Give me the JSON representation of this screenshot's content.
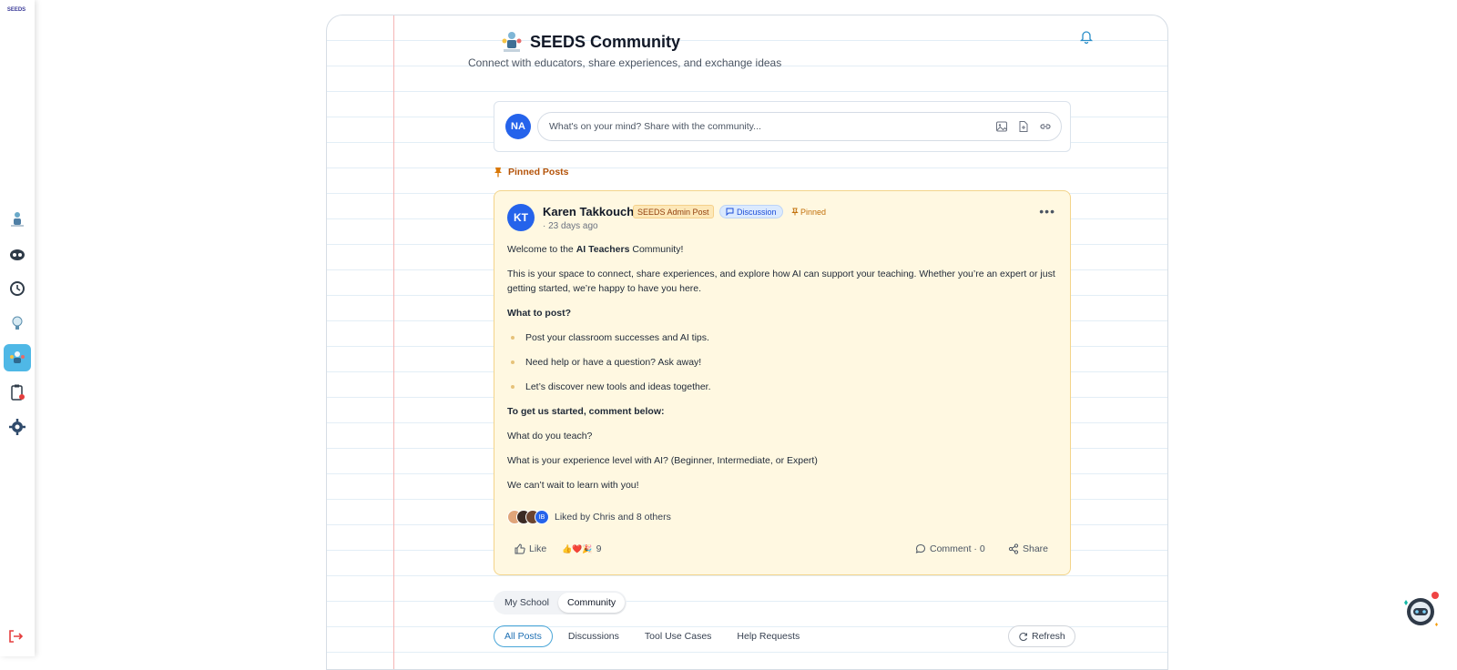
{
  "sidebar": {
    "logo_text": "SEEDS",
    "items": [
      {
        "icon": "robot-teacher-icon"
      },
      {
        "icon": "robot-eye-icon"
      },
      {
        "icon": "clock-icon"
      },
      {
        "icon": "lightbulb-icon"
      },
      {
        "icon": "community-icon",
        "active": true
      },
      {
        "icon": "clipboard-icon"
      },
      {
        "icon": "gear-icon"
      }
    ],
    "logout_icon": "logout-icon"
  },
  "header": {
    "title": "SEEDS Community",
    "subtitle": "Connect with educators, share experiences, and exchange ideas"
  },
  "composer": {
    "avatar_initials": "NA",
    "placeholder": "What's on your mind? Share with the community..."
  },
  "pinned_label": "Pinned Posts",
  "post": {
    "avatar_initials": "KT",
    "author": "Karen Takkouch",
    "badge_admin": "SEEDS Admin Post",
    "badge_type": "Discussion",
    "badge_pinned": "Pinned",
    "time": "· 23 days ago",
    "welcome_prefix": "Welcome to the ",
    "welcome_bold": "AI Teachers",
    "welcome_suffix": " Community!",
    "intro": "This is your space to connect, share experiences, and explore how AI can support your teaching. Whether you’re an expert or just getting started, we’re happy to have you here.",
    "what_to_post": "What to post?",
    "bullets": [
      "Post your classroom successes and AI tips.",
      "Need help or have a question? Ask away!",
      "Let’s discover new tools and ideas together."
    ],
    "get_started": "To get us started, comment below:",
    "q1": "What do you teach?",
    "q2": "What is your experience level with AI? (Beginner, Intermediate, or Expert)",
    "closing": "We can’t wait to learn with you!",
    "liked_by": "Liked by Chris and 8 others",
    "liker_badge": "IB",
    "like_label": "Like",
    "reactions": "👍❤️🎉",
    "reaction_count": "9",
    "comment_label": "Comment · 0",
    "share_label": "Share"
  },
  "tabs": {
    "my_school": "My School",
    "community": "Community"
  },
  "filters": [
    "All Posts",
    "Discussions",
    "Tool Use Cases",
    "Help Requests"
  ],
  "refresh_label": "Refresh",
  "colors": {
    "accent": "#2563eb",
    "sidebar_active": "#4fb8e6",
    "pinned_bg": "#fff8e1",
    "pinned_border": "#f3d48a"
  }
}
